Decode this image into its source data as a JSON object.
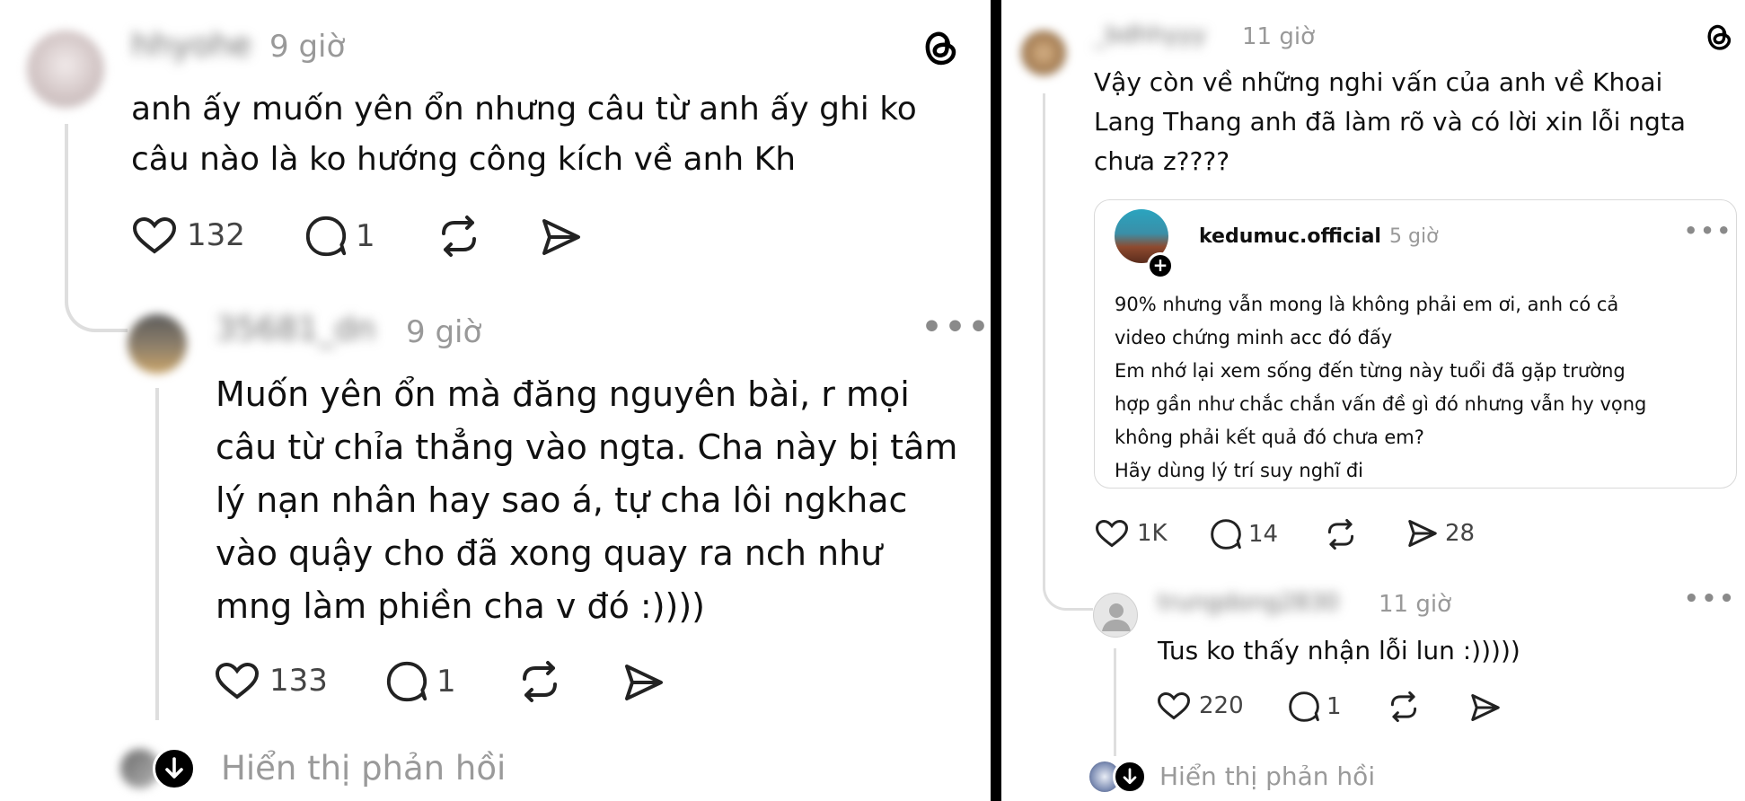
{
  "left": {
    "comment1": {
      "username": "hhyohe",
      "time": "9 giờ",
      "text_line1": "anh ấy muốn yên ổn nhưng câu từ anh ấy ghi ko",
      "text_line2": "câu nào là ko hướng công kích về anh Kh",
      "likes": "132",
      "replies": "1"
    },
    "comment2": {
      "username": "35681_dn",
      "time": "9 giờ",
      "lines": [
        "Muốn yên ổn mà đăng nguyên bài, r mọi",
        "câu từ chỉa thẳng vào ngta. Cha này bị tâm",
        "lý nạn nhân hay sao á, tự cha lôi ngkhac",
        "vào quậy cho đã xong quay ra nch như",
        "mng làm phiền cha v đó :))))"
      ],
      "likes": "133",
      "replies": "1"
    },
    "show_replies": "Hiển thị phản hồi"
  },
  "right": {
    "comment1": {
      "username": "_bdhhyyy",
      "time": "11 giờ",
      "lines": [
        "Vậy còn về những nghi vấn của anh về Khoai",
        "Lang Thang anh đã làm rõ và có lời xin lỗi ngta",
        "chưa z????"
      ],
      "likes": "1K",
      "replies": "14",
      "shares": "28"
    },
    "quote": {
      "username": "kedumuc.official",
      "time": "5 giờ",
      "lines": [
        "90% nhưng vẫn mong là không phải em ơi, anh có cả",
        "video chứng minh acc đó đấy",
        "Em nhớ lại xem sống đến từng này tuổi đã gặp trường",
        "hợp gần như chắc chắn vấn đề gì đó nhưng vẫn hy vọng",
        "không phải kết quả đó chưa em?",
        "Hãy dùng lý trí suy nghĩ đi"
      ]
    },
    "comment2": {
      "username": "trungdong2830",
      "time": "11 giờ",
      "text": "Tus ko thấy nhận lỗi lun :)))))",
      "likes": "220",
      "replies": "1"
    },
    "show_replies": "Hiển thị phản hồi"
  },
  "colors": {
    "text": "#101010",
    "muted": "#999999",
    "thread": "#dedede",
    "accent": "#000000"
  },
  "icons": [
    "threads-logo-icon",
    "heart-icon",
    "comment-icon",
    "repost-icon",
    "share-icon",
    "more-icon",
    "arrow-down-icon"
  ]
}
